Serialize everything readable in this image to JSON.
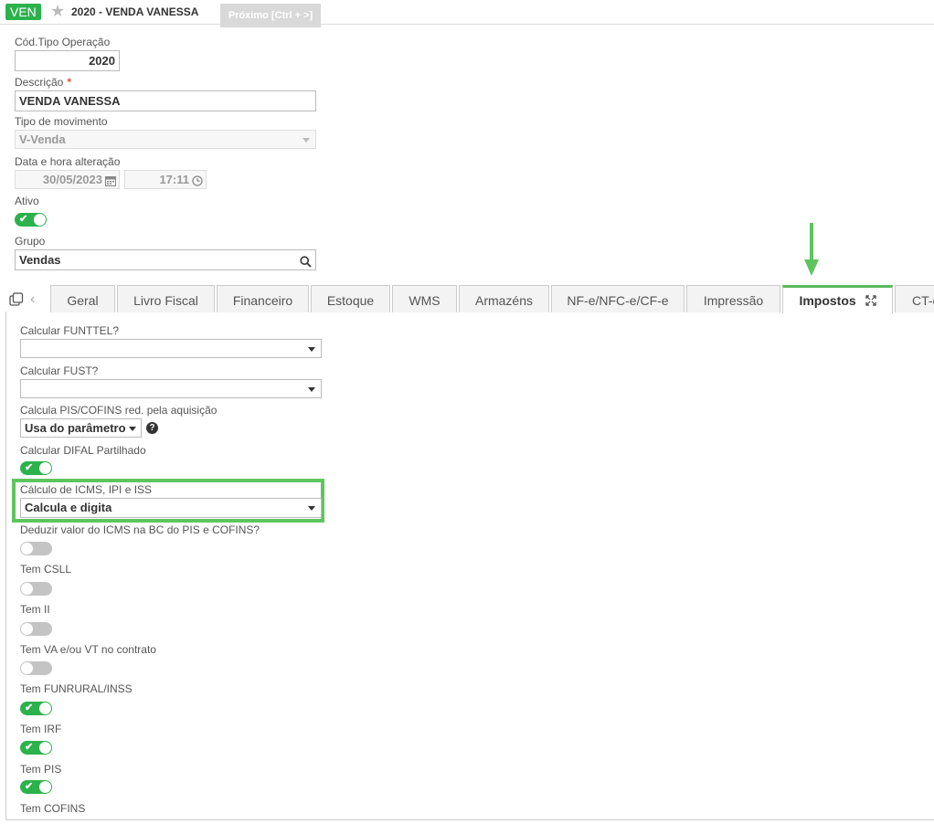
{
  "header": {
    "badge": "VEN",
    "title": "2020 - VENDA VANESSA",
    "next_button": "Próximo [Ctrl + >]"
  },
  "form": {
    "cod_tipo_label": "Cód.Tipo Operação",
    "cod_tipo_value": "2020",
    "descricao_label": "Descrição",
    "descricao_required": "*",
    "descricao_value": "VENDA VANESSA",
    "tipo_mov_label": "Tipo de movimento",
    "tipo_mov_value": "V-Venda",
    "data_hora_label": "Data e hora alteração",
    "data_value": "30/05/2023",
    "hora_value": "17:11",
    "ativo_label": "Ativo",
    "ativo_on": true,
    "grupo_label": "Grupo",
    "grupo_value": "Vendas"
  },
  "tabs": [
    {
      "label": "Geral"
    },
    {
      "label": "Livro Fiscal"
    },
    {
      "label": "Financeiro"
    },
    {
      "label": "Estoque"
    },
    {
      "label": "WMS"
    },
    {
      "label": "Armazéns"
    },
    {
      "label": "NF-e/NFC-e/CF-e"
    },
    {
      "label": "Impressão"
    },
    {
      "label": "Impostos",
      "active": true
    },
    {
      "label": "CT-e"
    }
  ],
  "impostos": {
    "funttel_label": "Calcular FUNTTEL?",
    "funttel_value": "",
    "fust_label": "Calcular FUST?",
    "fust_value": "",
    "pis_cofins_red_label": "Calcula PIS/COFINS red. pela aquisição",
    "pis_cofins_red_value": "Usa do parâmetro",
    "difal_label": "Calcular DIFAL Partilhado",
    "difal_on": true,
    "calc_icms_label": "Cálculo de ICMS, IPI e ISS",
    "calc_icms_value": "Calcula e digita",
    "deduzir_label": "Deduzir valor do ICMS na BC do PIS e COFINS?",
    "deduzir_on": false,
    "csll_label": "Tem CSLL",
    "csll_on": false,
    "ii_label": "Tem II",
    "ii_on": false,
    "va_vt_label": "Tem VA e/ou VT no contrato",
    "va_vt_on": false,
    "funrural_label": "Tem FUNRURAL/INSS",
    "funrural_on": true,
    "irf_label": "Tem IRF",
    "irf_on": true,
    "pis_label": "Tem PIS",
    "pis_on": true,
    "cofins_label": "Tem COFINS"
  },
  "colors": {
    "accent_green": "#2bb24c",
    "highlight_green": "#5ec55e",
    "toggle_off": "#c4c4c4"
  }
}
